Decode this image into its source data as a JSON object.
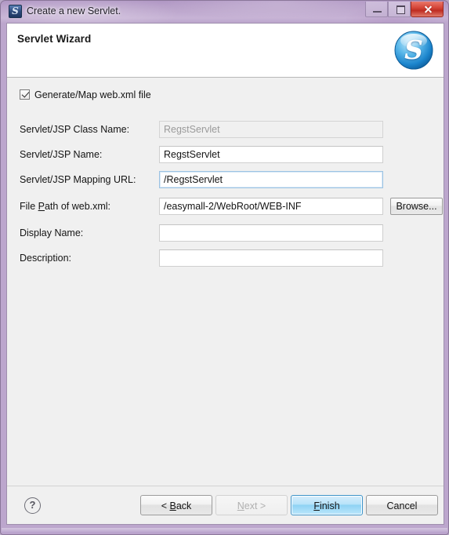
{
  "window": {
    "title": "Create a new Servlet.",
    "app_icon": "servlet-icon",
    "app_icon_glyph": "S",
    "controls": {
      "minimize": "minimize-icon",
      "maximize": "maximize-icon",
      "close": "close-icon"
    }
  },
  "header": {
    "title": "Servlet Wizard",
    "banner_icon": "servlet-banner-icon",
    "banner_glyph": "S",
    "banner_color": "#1f8fd6"
  },
  "form": {
    "generate_checkbox": {
      "label": "Generate/Map web.xml file",
      "checked": true
    },
    "fields": [
      {
        "label": "Servlet/JSP Class Name:",
        "value": "RegstServlet",
        "placeholder": "",
        "state": "disabled",
        "name": "servlet-class-name"
      },
      {
        "label": "Servlet/JSP Name:",
        "value": "RegstServlet",
        "placeholder": "",
        "state": "enabled",
        "name": "servlet-name"
      },
      {
        "label": "Servlet/JSP Mapping URL:",
        "value": "/RegstServlet",
        "placeholder": "",
        "state": "focused",
        "name": "servlet-mapping-url"
      },
      {
        "label_pre": "File ",
        "label_mnemonic": "P",
        "label_post": "ath of web.xml:",
        "label": "File Path of web.xml:",
        "value": "/easymall-2/WebRoot/WEB-INF",
        "placeholder": "",
        "state": "enabled",
        "name": "web-xml-path"
      },
      {
        "label": "Display Name:",
        "value": "",
        "placeholder": "",
        "state": "enabled",
        "name": "display-name"
      },
      {
        "label": "Description:",
        "value": "",
        "placeholder": "",
        "state": "enabled",
        "name": "description"
      }
    ],
    "browse_button": "Browse..."
  },
  "buttons": {
    "help": "?",
    "back": {
      "pre": "< ",
      "mnemonic": "B",
      "post": "ack",
      "label": "< Back",
      "enabled": true
    },
    "next": {
      "pre": "",
      "mnemonic": "N",
      "post": "ext >",
      "label": "Next >",
      "enabled": false
    },
    "finish": {
      "pre": "",
      "mnemonic": "F",
      "post": "inish",
      "label": "Finish",
      "enabled": true,
      "default": true
    },
    "cancel": {
      "pre": "",
      "mnemonic": "",
      "post": "Cancel",
      "label": "Cancel",
      "enabled": true
    }
  },
  "colors": {
    "frame": "#bba6cb",
    "client_bg": "#f0f0f0",
    "header_bg": "#ffffff",
    "close_button": "#d6473a",
    "default_button": "#8ed2f4"
  }
}
